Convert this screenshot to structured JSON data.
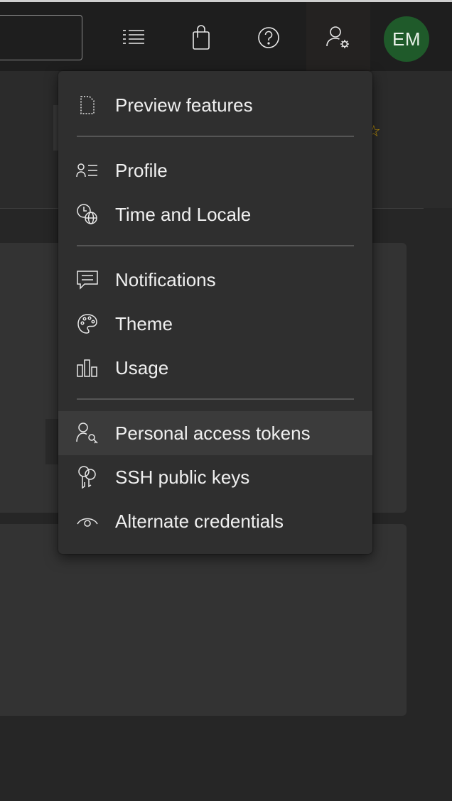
{
  "topbar": {
    "avatar_initials": "EM",
    "icons": [
      "list-icon",
      "shopping-bag-icon",
      "help-icon",
      "user-settings-icon"
    ]
  },
  "menu": {
    "groups": [
      [
        {
          "label": "Preview features",
          "icon": "preview-icon"
        }
      ],
      [
        {
          "label": "Profile",
          "icon": "profile-icon"
        },
        {
          "label": "Time and Locale",
          "icon": "time-locale-icon"
        }
      ],
      [
        {
          "label": "Notifications",
          "icon": "notifications-icon"
        },
        {
          "label": "Theme",
          "icon": "theme-icon"
        },
        {
          "label": "Usage",
          "icon": "usage-icon"
        }
      ],
      [
        {
          "label": "Personal access tokens",
          "icon": "key-user-icon",
          "hovered": true
        },
        {
          "label": "SSH public keys",
          "icon": "keys-icon"
        },
        {
          "label": "Alternate credentials",
          "icon": "eye-icon"
        }
      ]
    ]
  },
  "colors": {
    "avatar_bg": "#1f5a2a",
    "menu_bg": "#2f2f2f",
    "hover_bg": "#3b3b3b",
    "star_accent": "#d9a400"
  }
}
